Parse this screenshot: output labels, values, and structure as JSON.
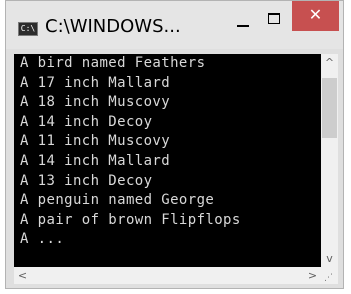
{
  "window": {
    "title": "C:\\WINDOWS...",
    "app_icon_text": "C:\\",
    "close_glyph": "✕"
  },
  "console": {
    "lines": [
      "A bird named Feathers",
      "A 17 inch Mallard",
      "A 18 inch Muscovy",
      "A 14 inch Decoy",
      "A 11 inch Muscovy",
      "A 14 inch Mallard",
      "A 13 inch Decoy",
      "A penguin named George",
      "A pair of brown Flipflops",
      "A ..."
    ]
  },
  "scrollbars": {
    "up_glyph": "^",
    "down_glyph": "v",
    "left_glyph": "<",
    "right_glyph": ">"
  },
  "icons": {
    "app": "console-app-icon",
    "minimize": "minimize-icon",
    "maximize": "maximize-icon",
    "close": "close-icon"
  },
  "colors": {
    "console_bg": "#000000",
    "console_fg": "#d8d8d8",
    "close_button": "#c75050",
    "titlebar": "#e5e5e5"
  }
}
